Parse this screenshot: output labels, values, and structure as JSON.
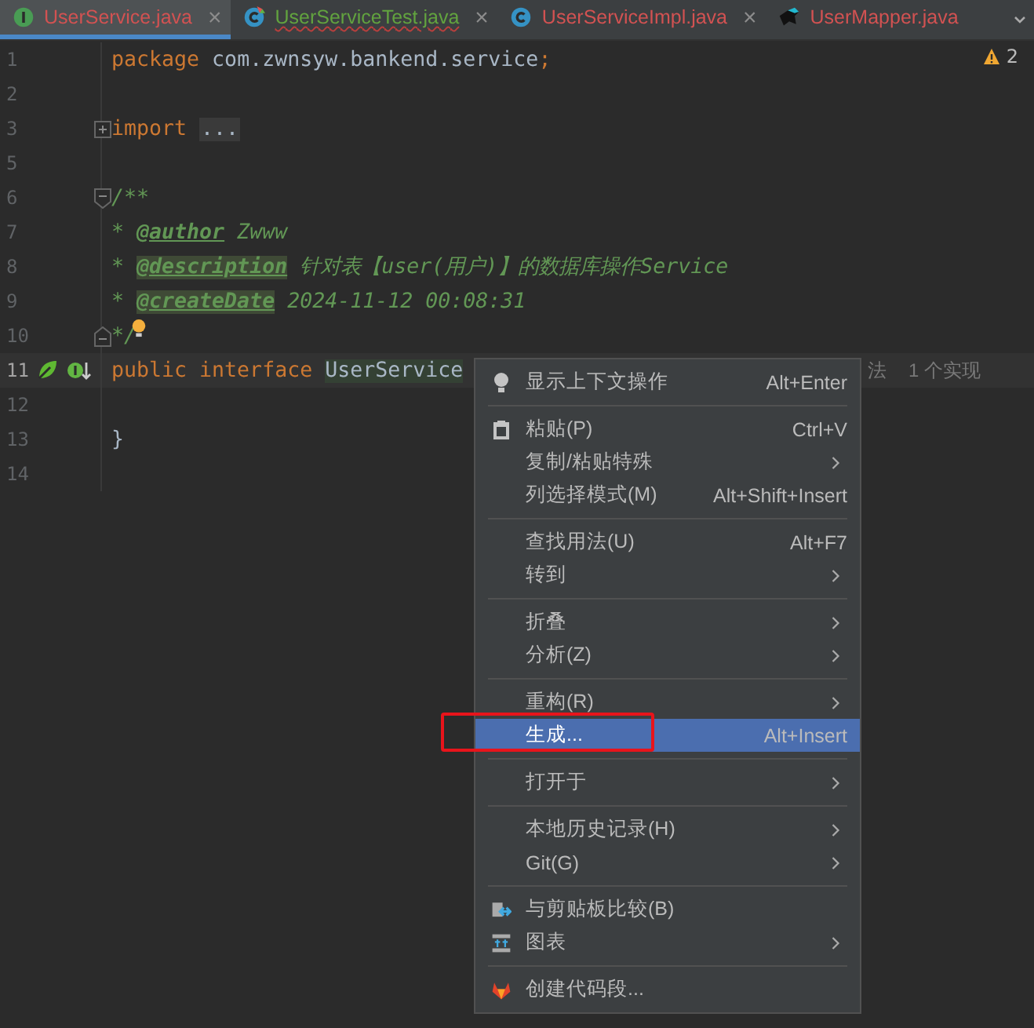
{
  "tabs": [
    {
      "label": "UserService.java",
      "kind": "interface",
      "selected": true,
      "color": "#d25252",
      "error": false,
      "close": "×"
    },
    {
      "label": "UserServiceTest.java",
      "kind": "test-class",
      "selected": false,
      "color": "#62a33f",
      "error": true,
      "close": "×"
    },
    {
      "label": "UserServiceImpl.java",
      "kind": "class",
      "selected": false,
      "color": "#d25252",
      "error": false,
      "close": "×"
    },
    {
      "label": "UserMapper.java",
      "kind": "mapper",
      "selected": false,
      "color": "#d25252",
      "error": false
    }
  ],
  "warnings": "2",
  "lines": [
    {
      "number": "1",
      "segments": [
        {
          "text": "package",
          "kind": "keyword"
        },
        {
          "text": " com.zwnsyw.bankend.service",
          "kind": "plain"
        },
        {
          "text": ";",
          "kind": "keyword"
        }
      ]
    },
    {
      "number": "2"
    },
    {
      "number": "3",
      "segments": [
        {
          "text": "import",
          "kind": "keyword"
        },
        {
          "text": "...",
          "kind": "folded"
        }
      ],
      "kind": "fold-collapsed"
    },
    {
      "number": "5"
    },
    {
      "number": "6",
      "segments": [
        {
          "text": "/**",
          "kind": "comment"
        }
      ],
      "kind": "fold-start"
    },
    {
      "number": "7",
      "segments": [
        {
          "text": "* ",
          "kind": "comment"
        },
        {
          "text": "@author",
          "kind": "tag"
        },
        {
          "text": " Zwww",
          "kind": "comment"
        }
      ]
    },
    {
      "number": "8",
      "segments": [
        {
          "text": "* ",
          "kind": "comment"
        },
        {
          "text": "@description",
          "kind": "tag-box"
        },
        {
          "text": " 针对表【user(用户)】的数据库操作Service",
          "kind": "comment"
        }
      ]
    },
    {
      "number": "9",
      "segments": [
        {
          "text": "* ",
          "kind": "comment"
        },
        {
          "text": "@createDate",
          "kind": "tag-box"
        },
        {
          "text": " 2024-11-12 00:08:31",
          "kind": "comment"
        }
      ]
    },
    {
      "number": "10",
      "segments": [
        {
          "text": "*/",
          "kind": "comment"
        }
      ],
      "kind": "fold-end",
      "bulb": true
    },
    {
      "number": "11",
      "segments": [
        {
          "text": "public interface",
          "kind": "keyword"
        },
        {
          "text": "UserService",
          "kind": "ident-box"
        }
      ],
      "current": true,
      "markers": true,
      "hints": [
        "法",
        "1 个实现"
      ]
    },
    {
      "number": "12"
    },
    {
      "number": "13",
      "segments": [
        {
          "text": "}",
          "kind": "plain"
        }
      ]
    },
    {
      "number": "14"
    }
  ],
  "menu": [
    {
      "kind": "item",
      "label": "显示上下文操作",
      "shortcut": "Alt+Enter",
      "submenu": false,
      "selected": false
    },
    {
      "kind": "separator"
    },
    {
      "kind": "item",
      "label": "粘贴(P)",
      "shortcut": "Ctrl+V",
      "submenu": false,
      "selected": false
    },
    {
      "kind": "item",
      "label": "复制/粘贴特殊",
      "submenu": true,
      "selected": false
    },
    {
      "kind": "item",
      "label": "列选择模式(M)",
      "shortcut": "Alt+Shift+Insert",
      "submenu": false,
      "selected": false
    },
    {
      "kind": "separator"
    },
    {
      "kind": "item",
      "label": "查找用法(U)",
      "shortcut": "Alt+F7",
      "submenu": false,
      "selected": false
    },
    {
      "kind": "item",
      "label": "转到",
      "submenu": true,
      "selected": false
    },
    {
      "kind": "separator"
    },
    {
      "kind": "item",
      "label": "折叠",
      "submenu": true,
      "selected": false
    },
    {
      "kind": "item",
      "label": "分析(Z)",
      "submenu": true,
      "selected": false
    },
    {
      "kind": "separator"
    },
    {
      "kind": "item",
      "label": "重构(R)",
      "submenu": true,
      "selected": false
    },
    {
      "kind": "item",
      "label": "生成...",
      "shortcut": "Alt+Insert",
      "submenu": false,
      "selected": true,
      "highlighted": true
    },
    {
      "kind": "separator"
    },
    {
      "kind": "item",
      "label": "打开于",
      "submenu": true,
      "selected": false
    },
    {
      "kind": "separator"
    },
    {
      "kind": "item",
      "label": "本地历史记录(H)",
      "submenu": true,
      "selected": false
    },
    {
      "kind": "item",
      "label": "Git(G)",
      "submenu": true,
      "selected": false
    },
    {
      "kind": "separator"
    },
    {
      "kind": "item",
      "label": "与剪贴板比较(B)",
      "submenu": false,
      "selected": false
    },
    {
      "kind": "item",
      "label": "图表",
      "submenu": true,
      "selected": false
    },
    {
      "kind": "separator"
    },
    {
      "kind": "item",
      "label": "创建代码段...",
      "submenu": false,
      "selected": false
    }
  ]
}
